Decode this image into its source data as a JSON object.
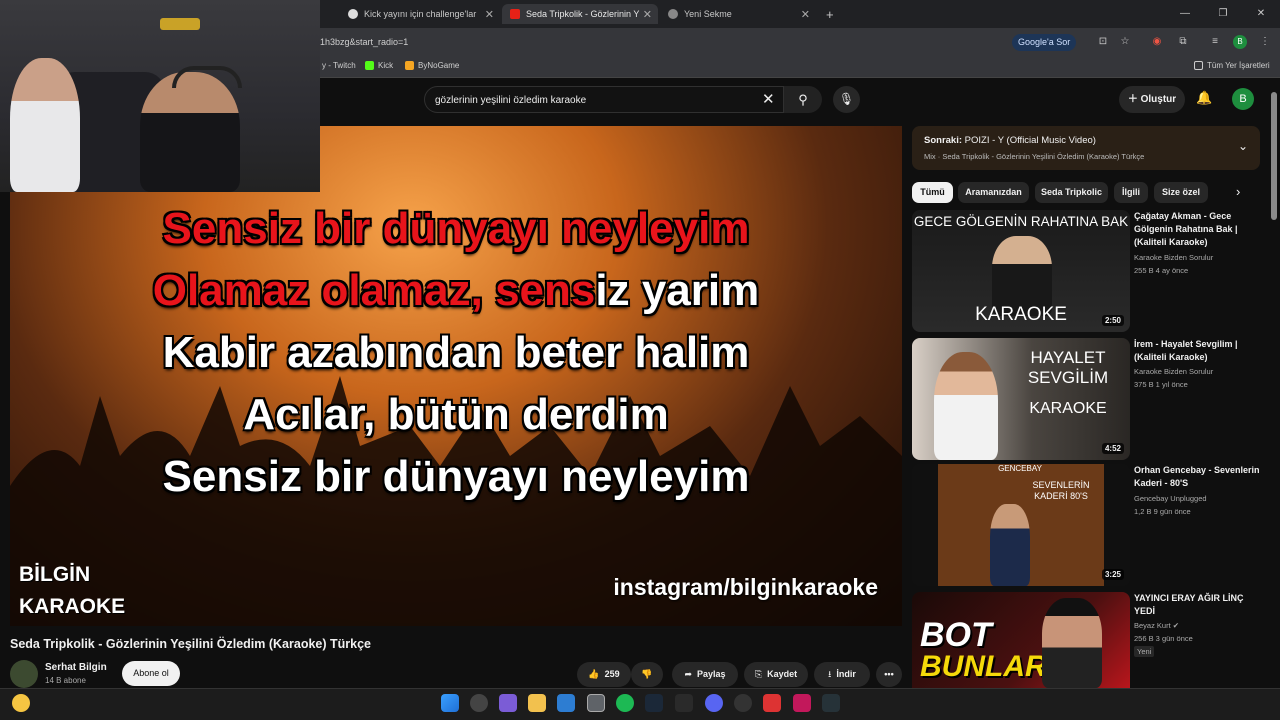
{
  "browser": {
    "tabs": [
      {
        "label": "Kick yayını için challenge'lar"
      },
      {
        "label": "Seda Tripkolik - Gözlerinin Y"
      },
      {
        "label": "Yeni Sekme"
      }
    ],
    "url_fragment": "1h3bzg&start_radio=1",
    "ask_google": "Google'a Sor",
    "profile_letter": "B",
    "bookmarks": [
      {
        "label": "y - Twitch"
      },
      {
        "label": "Kick"
      },
      {
        "label": "ByNoGame"
      }
    ],
    "all_bookmarks": "Tüm Yer İşaretleri"
  },
  "youtube": {
    "search_value": "gözlerinin yeşilini özledim karaoke",
    "create_label": "Oluştur",
    "avatar_letter": "B"
  },
  "player": {
    "lyrics": [
      {
        "red": "Sensiz bir dünyayı neyleyim",
        "white": ""
      },
      {
        "red": "Olamaz olamaz, sens",
        "white": "iz yarim"
      },
      {
        "red": "",
        "white": "Kabir azabından beter halim"
      },
      {
        "red": "",
        "white": "Acılar, bütün derdim"
      },
      {
        "red": "",
        "white": "Sensiz bir dünyayı neyleyim"
      }
    ],
    "brand_line1": "BİLGİN",
    "brand_line2": "KARAOKE",
    "instagram": "instagram/bilginkaraoke"
  },
  "video": {
    "title": "Seda Tripkolik - Gözlerinin Yeşilini Özledim (Karaoke) Türkçe",
    "channel": "Serhat Bilgin",
    "subscribers": "14 B abone",
    "subscribe_label": "Abone ol",
    "likes": "259",
    "share_label": "Paylaş",
    "save_label": "Kaydet",
    "download_label": "İndir"
  },
  "sidebar": {
    "next_label": "Sonraki:",
    "next_title": "POIZI - Y (Official Music Video)",
    "next_mix": "Mix · Seda Tripkolik - Gözlerinin Yeşilini Özledim (Karaoke) Türkçe",
    "chips": [
      "Tümü",
      "Aramanızdan",
      "Seda Tripkolic",
      "İlgili",
      "Size özel"
    ],
    "videos": [
      {
        "thumb_text": "GECE GÖLGENİN RAHATINA BAK",
        "thumb_sub": "KARAOKE",
        "duration": "2:50",
        "title": "Çağatay Akman - Gece Gölgenin Rahatına Bak | (Kaliteli Karaoke)",
        "channel": "Karaoke Bizden Sorulur",
        "meta": "255 B   4 ay önce"
      },
      {
        "thumb_text": "HAYALET SEVGİLİM",
        "thumb_sub": "KARAOKE",
        "duration": "4:52",
        "title": "İrem - Hayalet Sevgilim | (Kaliteli Karaoke)",
        "channel": "Karaoke Bizden Sorulur",
        "meta": "375 B   1 yıl önce"
      },
      {
        "thumb_text": "SEVENLERİN KADERİ 80'S",
        "thumb_sub": "GENCEBAY",
        "duration": "3:25",
        "title": "Orhan Gencebay - Sevenlerin Kaderi - 80'S",
        "channel": "Gencebay Unplugged",
        "meta": "1,2 B   9 gün önce"
      },
      {
        "thumb_text": "BOT",
        "thumb_sub": "BUNLAR",
        "duration": "",
        "title": "YAYINCI ERAY AĞIR LİNÇ YEDİ",
        "channel": "Beyaz Kurt",
        "meta": "256 B   3 gün önce",
        "badge": "Yeni"
      }
    ]
  }
}
